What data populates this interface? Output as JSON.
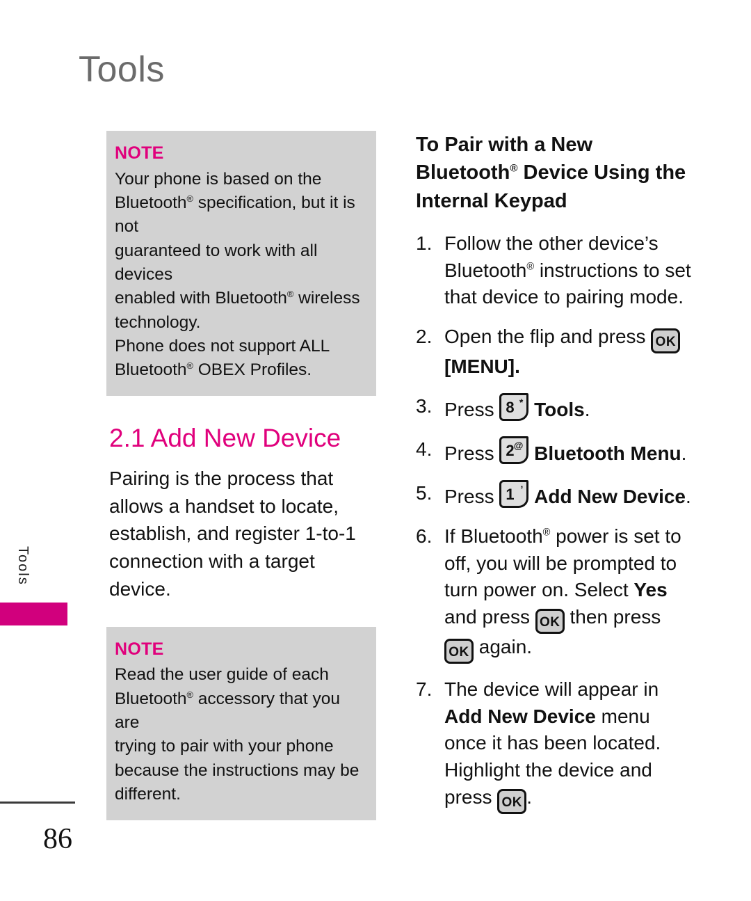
{
  "page": {
    "title": "Tools",
    "side_tab_label": "Tools",
    "number": "86"
  },
  "left_column": {
    "note_top": {
      "label": "NOTE",
      "lines": [
        "Your phone is based on the",
        "Bluetooth® specification, but it is not",
        "guaranteed to work with all devices",
        "enabled with Bluetooth® wireless",
        "technology.",
        "Phone does not support ALL",
        "Bluetooth® OBEX Profiles."
      ],
      "text": "Your phone is based on the Bluetooth® specification, but it is not guaranteed to work with all devices enabled with Bluetooth® wireless technology. Phone does not support ALL Bluetooth® OBEX Profiles."
    },
    "section": {
      "heading": "2.1 Add New Device",
      "paragraph": "Pairing is the process that allows a handset to locate, establish, and register 1-to-1 connection with a target device."
    },
    "note_bottom": {
      "label": "NOTE",
      "text": "Read the user guide of each Bluetooth® accessory that you are trying to pair with your phone because the instructions may be different."
    }
  },
  "right_column": {
    "heading": "To Pair with a New Bluetooth® Device Using the Internal Keypad",
    "steps": [
      {
        "num": "1.",
        "text": "Follow the other device’s Bluetooth® instructions to set that device to pairing mode."
      },
      {
        "num": "2.",
        "pre": "Open the flip and press",
        "key": "OK",
        "post": "[MENU]."
      },
      {
        "num": "3.",
        "pre": "Press",
        "key_digit": "8",
        "key_alt": "*",
        "bold": "Tools",
        "post": "."
      },
      {
        "num": "4.",
        "pre": "Press",
        "key_digit": "2",
        "key_alt": "@",
        "bold": "Bluetooth Menu",
        "post": "."
      },
      {
        "num": "5.",
        "pre": "Press",
        "key_digit": "1",
        "key_alt": "’",
        "bold": "Add New Device",
        "post": "."
      },
      {
        "num": "6.",
        "seg1": "If Bluetooth® power is set to off, you will be prompted to turn power on. Select ",
        "bold1": "Yes",
        "seg2": " and press ",
        "key1": "OK",
        "seg3": " then press ",
        "key2": "OK",
        "seg4": " again."
      },
      {
        "num": "7.",
        "seg1": "The device will appear in ",
        "bold1": "Add New Device",
        "seg2": " menu once it has been located. Highlight the device and press ",
        "key1": "OK",
        "seg3": "."
      }
    ]
  },
  "colors": {
    "magenta": "#d1007d",
    "note_pink": "#e0007c",
    "note_box_gray": "#d2d2d2",
    "title_gray": "#6b6b6b",
    "key_fill": "#cfcfcf"
  }
}
